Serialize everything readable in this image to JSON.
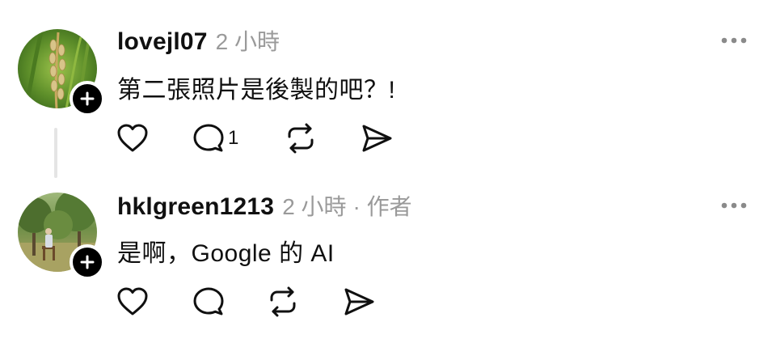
{
  "comments": [
    {
      "username": "lovejl07",
      "time": "2 小時",
      "author_tag": "",
      "text": "第二張照片是後製的吧？!",
      "avatar_icon": "rice-plant-photo",
      "actions": {
        "like_count": "",
        "reply_count": "1",
        "repost_count": "",
        "share_count": ""
      }
    },
    {
      "username": "hklgreen1213",
      "time": "2 小時",
      "author_tag": "· 作者",
      "text": "是啊，Google 的 AI",
      "avatar_icon": "garden-person-photo",
      "actions": {
        "like_count": "",
        "reply_count": "",
        "repost_count": "",
        "share_count": ""
      }
    }
  ],
  "icons": {
    "like": "heart-icon",
    "reply": "speech-bubble-icon",
    "repost": "repost-icon",
    "share": "send-icon",
    "more": "more-dots-icon",
    "follow": "plus-icon"
  },
  "colors": {
    "text": "#101010",
    "meta": "#9a9a9a",
    "thread_line": "#e5e5e5",
    "badge": "#000000"
  }
}
